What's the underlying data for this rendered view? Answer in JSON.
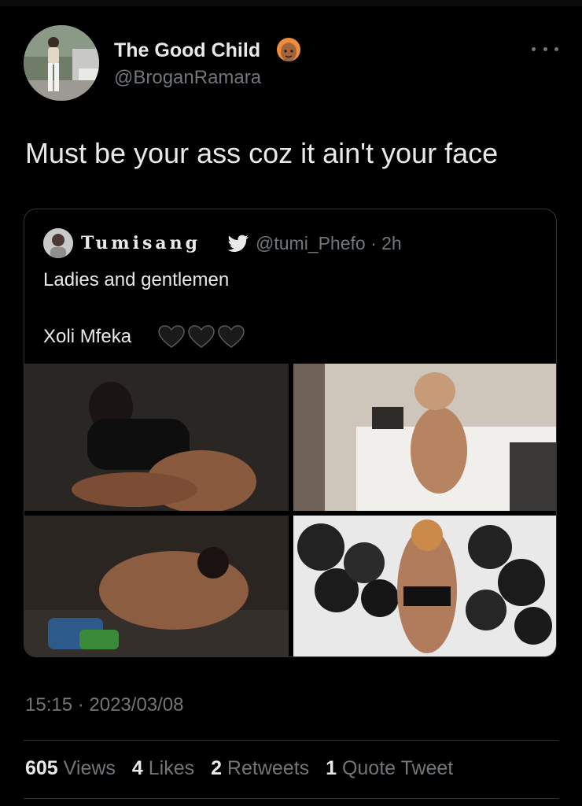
{
  "author": {
    "display_name": "The Good Child",
    "handle": "@BroganRamara"
  },
  "tweet": {
    "text": "Must be your ass coz it ain't your face",
    "timestamp": "15:15 · 2023/03/08"
  },
  "quoted": {
    "display_name": "Tumisang",
    "meta": "@tumi_Phefo · 2h",
    "line1": "Ladies and gentlemen",
    "line2": "Xoli Mfeka"
  },
  "stats": {
    "views_count": "605",
    "views_label": "Views",
    "likes_count": "4",
    "likes_label": "Likes",
    "retweets_count": "2",
    "retweets_label": "Retweets",
    "quotes_count": "1",
    "quotes_label": "Quote Tweet"
  },
  "icons": {
    "name_emoji": "woman-emoji-icon",
    "badge": "twitter-bird-icon",
    "hearts": "black-heart-icon",
    "more": "more-options-icon"
  },
  "colors": {
    "background": "#000000",
    "text_primary": "#e7e9ea",
    "text_secondary": "#71767b",
    "border": "#2f3336"
  }
}
